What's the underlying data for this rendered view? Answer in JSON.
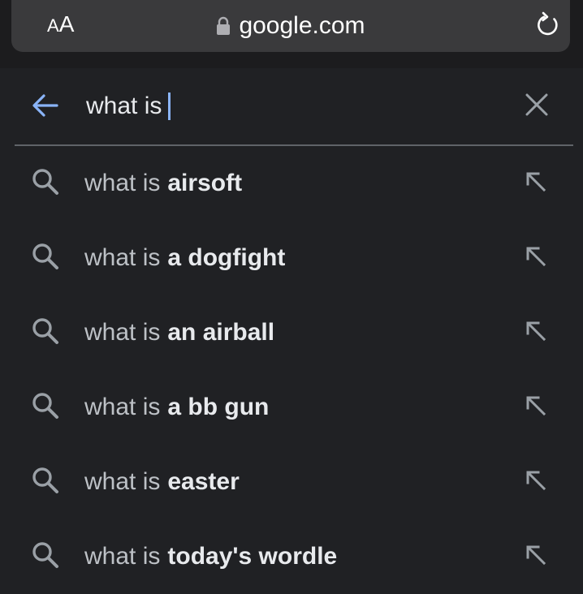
{
  "browser": {
    "text_size_label_small": "A",
    "text_size_label_big": "A",
    "domain": "google.com",
    "icons": {
      "lock": "lock-icon",
      "reload": "reload-icon"
    }
  },
  "search": {
    "query": "what is",
    "icons": {
      "back": "back-arrow-icon",
      "clear": "close-icon"
    },
    "colors": {
      "accent": "#8ab4f8",
      "background": "#202124"
    }
  },
  "suggestions": [
    {
      "prefix": "what is",
      "completion": "airsoft"
    },
    {
      "prefix": "what is",
      "completion": "a dogfight"
    },
    {
      "prefix": "what is",
      "completion": "an airball"
    },
    {
      "prefix": "what is",
      "completion": "a bb gun"
    },
    {
      "prefix": "what is",
      "completion": "easter"
    },
    {
      "prefix": "what is",
      "completion": "today's wordle"
    }
  ]
}
